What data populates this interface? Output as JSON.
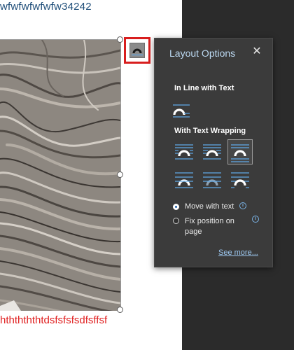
{
  "document": {
    "top_text": "wfwfwfwfwfw34242",
    "bottom_text": "hththththtdsfsfsfsdfsffsf"
  },
  "layout_button": {
    "icon": "layout-options-icon",
    "highlight_color": "#d81e1e"
  },
  "panel": {
    "title": "Layout Options",
    "close_icon": "close-icon",
    "inline_section": "In Line with Text",
    "wrapping_section": "With Text Wrapping",
    "move_with_text": "Move with text",
    "fix_position_line1": "Fix position on",
    "fix_position_line2": "page",
    "see_more": "See more...",
    "selected_option": "Top and Bottom"
  },
  "colors": {
    "panel_bg": "#3b3b3b",
    "accent_blue": "#5fa9e8",
    "title_blue": "#bcd9f2",
    "text_red": "#e02020",
    "text_navy": "#1f4e79"
  }
}
